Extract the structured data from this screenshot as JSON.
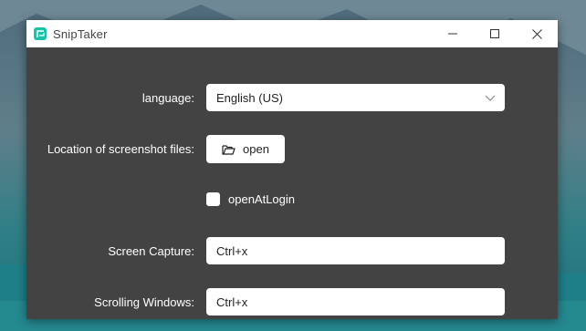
{
  "window": {
    "title": "SnipTaker",
    "controls": [
      "minimize-icon",
      "maximize-icon",
      "close-icon"
    ]
  },
  "settings": {
    "language": {
      "label": "language:",
      "value": "English (US)"
    },
    "location": {
      "label": "Location of screenshot files:",
      "button_label": "open",
      "button_icon": "folder-open-icon"
    },
    "open_at_login": {
      "label": "openAtLogin",
      "checked": false
    },
    "screen_capture": {
      "label": "Screen Capture:",
      "value": "Ctrl+x"
    },
    "scrolling_windows": {
      "label": "Scrolling Windows:",
      "value": "Ctrl+x"
    }
  },
  "colors": {
    "accent": "#19c2a9",
    "panel": "#434343",
    "titlebar": "#ffffff"
  }
}
